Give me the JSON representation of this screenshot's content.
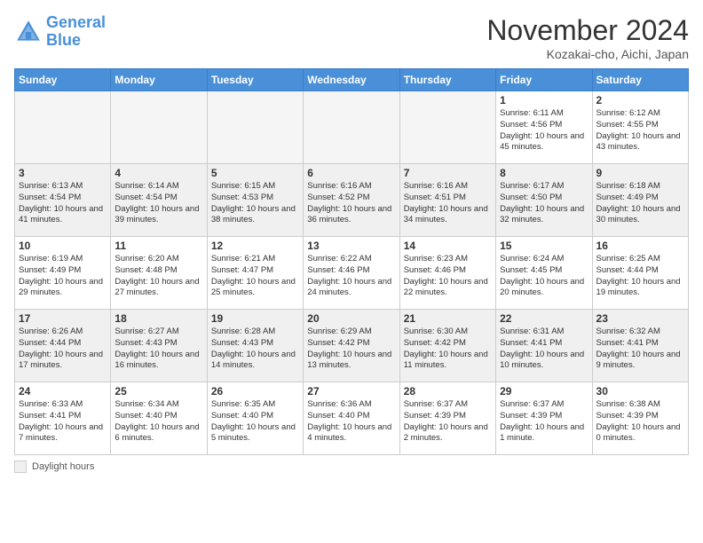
{
  "logo": {
    "line1": "General",
    "line2": "Blue"
  },
  "title": "November 2024",
  "subtitle": "Kozakai-cho, Aichi, Japan",
  "legend": {
    "label": "Daylight hours"
  },
  "weekdays": [
    "Sunday",
    "Monday",
    "Tuesday",
    "Wednesday",
    "Thursday",
    "Friday",
    "Saturday"
  ],
  "weeks": [
    [
      {
        "day": "",
        "info": ""
      },
      {
        "day": "",
        "info": ""
      },
      {
        "day": "",
        "info": ""
      },
      {
        "day": "",
        "info": ""
      },
      {
        "day": "",
        "info": ""
      },
      {
        "day": "1",
        "info": "Sunrise: 6:11 AM\nSunset: 4:56 PM\nDaylight: 10 hours\nand 45 minutes."
      },
      {
        "day": "2",
        "info": "Sunrise: 6:12 AM\nSunset: 4:55 PM\nDaylight: 10 hours\nand 43 minutes."
      }
    ],
    [
      {
        "day": "3",
        "info": "Sunrise: 6:13 AM\nSunset: 4:54 PM\nDaylight: 10 hours\nand 41 minutes."
      },
      {
        "day": "4",
        "info": "Sunrise: 6:14 AM\nSunset: 4:54 PM\nDaylight: 10 hours\nand 39 minutes."
      },
      {
        "day": "5",
        "info": "Sunrise: 6:15 AM\nSunset: 4:53 PM\nDaylight: 10 hours\nand 38 minutes."
      },
      {
        "day": "6",
        "info": "Sunrise: 6:16 AM\nSunset: 4:52 PM\nDaylight: 10 hours\nand 36 minutes."
      },
      {
        "day": "7",
        "info": "Sunrise: 6:16 AM\nSunset: 4:51 PM\nDaylight: 10 hours\nand 34 minutes."
      },
      {
        "day": "8",
        "info": "Sunrise: 6:17 AM\nSunset: 4:50 PM\nDaylight: 10 hours\nand 32 minutes."
      },
      {
        "day": "9",
        "info": "Sunrise: 6:18 AM\nSunset: 4:49 PM\nDaylight: 10 hours\nand 30 minutes."
      }
    ],
    [
      {
        "day": "10",
        "info": "Sunrise: 6:19 AM\nSunset: 4:49 PM\nDaylight: 10 hours\nand 29 minutes."
      },
      {
        "day": "11",
        "info": "Sunrise: 6:20 AM\nSunset: 4:48 PM\nDaylight: 10 hours\nand 27 minutes."
      },
      {
        "day": "12",
        "info": "Sunrise: 6:21 AM\nSunset: 4:47 PM\nDaylight: 10 hours\nand 25 minutes."
      },
      {
        "day": "13",
        "info": "Sunrise: 6:22 AM\nSunset: 4:46 PM\nDaylight: 10 hours\nand 24 minutes."
      },
      {
        "day": "14",
        "info": "Sunrise: 6:23 AM\nSunset: 4:46 PM\nDaylight: 10 hours\nand 22 minutes."
      },
      {
        "day": "15",
        "info": "Sunrise: 6:24 AM\nSunset: 4:45 PM\nDaylight: 10 hours\nand 20 minutes."
      },
      {
        "day": "16",
        "info": "Sunrise: 6:25 AM\nSunset: 4:44 PM\nDaylight: 10 hours\nand 19 minutes."
      }
    ],
    [
      {
        "day": "17",
        "info": "Sunrise: 6:26 AM\nSunset: 4:44 PM\nDaylight: 10 hours\nand 17 minutes."
      },
      {
        "day": "18",
        "info": "Sunrise: 6:27 AM\nSunset: 4:43 PM\nDaylight: 10 hours\nand 16 minutes."
      },
      {
        "day": "19",
        "info": "Sunrise: 6:28 AM\nSunset: 4:43 PM\nDaylight: 10 hours\nand 14 minutes."
      },
      {
        "day": "20",
        "info": "Sunrise: 6:29 AM\nSunset: 4:42 PM\nDaylight: 10 hours\nand 13 minutes."
      },
      {
        "day": "21",
        "info": "Sunrise: 6:30 AM\nSunset: 4:42 PM\nDaylight: 10 hours\nand 11 minutes."
      },
      {
        "day": "22",
        "info": "Sunrise: 6:31 AM\nSunset: 4:41 PM\nDaylight: 10 hours\nand 10 minutes."
      },
      {
        "day": "23",
        "info": "Sunrise: 6:32 AM\nSunset: 4:41 PM\nDaylight: 10 hours\nand 9 minutes."
      }
    ],
    [
      {
        "day": "24",
        "info": "Sunrise: 6:33 AM\nSunset: 4:41 PM\nDaylight: 10 hours\nand 7 minutes."
      },
      {
        "day": "25",
        "info": "Sunrise: 6:34 AM\nSunset: 4:40 PM\nDaylight: 10 hours\nand 6 minutes."
      },
      {
        "day": "26",
        "info": "Sunrise: 6:35 AM\nSunset: 4:40 PM\nDaylight: 10 hours\nand 5 minutes."
      },
      {
        "day": "27",
        "info": "Sunrise: 6:36 AM\nSunset: 4:40 PM\nDaylight: 10 hours\nand 4 minutes."
      },
      {
        "day": "28",
        "info": "Sunrise: 6:37 AM\nSunset: 4:39 PM\nDaylight: 10 hours\nand 2 minutes."
      },
      {
        "day": "29",
        "info": "Sunrise: 6:37 AM\nSunset: 4:39 PM\nDaylight: 10 hours\nand 1 minute."
      },
      {
        "day": "30",
        "info": "Sunrise: 6:38 AM\nSunset: 4:39 PM\nDaylight: 10 hours\nand 0 minutes."
      }
    ]
  ]
}
